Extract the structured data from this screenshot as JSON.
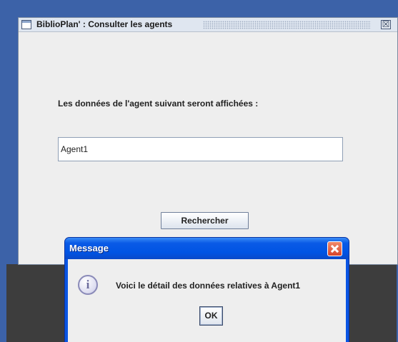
{
  "main_window": {
    "title": "BiblioPlan' : Consulter les agents",
    "prompt_label": "Les données de l'agent suivant seront affichées :",
    "agent_field_value": "Agent1",
    "search_button_label": "Rechercher",
    "close_glyph": "☒"
  },
  "dialog": {
    "title": "Message",
    "message": "Voici le détail des données relatives à Agent1",
    "ok_label": "OK",
    "info_glyph": "i"
  },
  "icons": {
    "window_icon": "window-icon",
    "main_close": "close-icon",
    "dialog_close": "close-icon",
    "info": "info-icon"
  },
  "colors": {
    "outer_frame": "#3c62a8",
    "window_bg": "#eeeeee",
    "dialog_title": "#0054e3",
    "dialog_close": "#d8442a"
  }
}
